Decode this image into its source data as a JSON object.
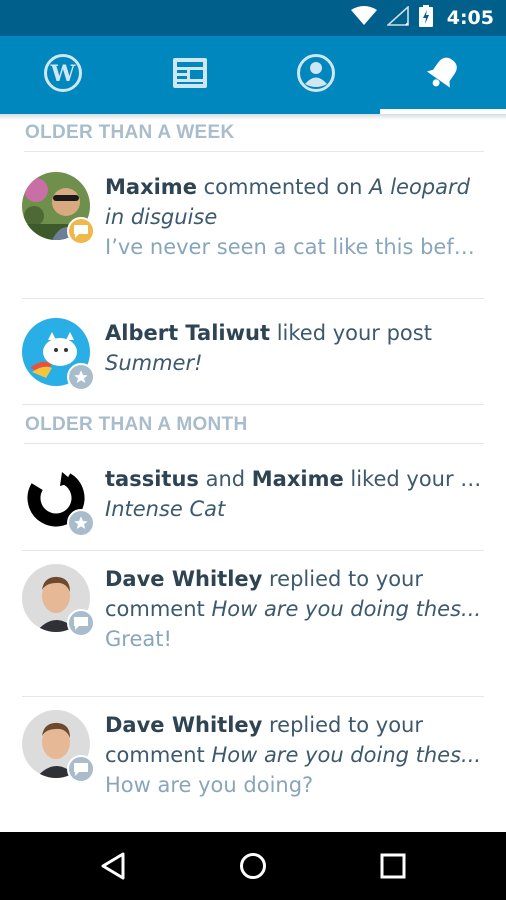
{
  "status_bar": {
    "time": "4:05"
  },
  "tabs": [
    {
      "icon": "wordpress-icon",
      "label": "My Sites",
      "active": false
    },
    {
      "icon": "reader-icon",
      "label": "Reader",
      "active": false
    },
    {
      "icon": "me-icon",
      "label": "Me",
      "active": false
    },
    {
      "icon": "notifications-bell-icon",
      "label": "Notifications",
      "active": true
    }
  ],
  "sections": [
    {
      "title": "OLDER THAN A WEEK"
    },
    {
      "title": "OLDER THAN A MONTH"
    }
  ],
  "notes": [
    {
      "actor": "Maxime",
      "action": " commented on ",
      "target": "A leopard in disguise",
      "snippet": "I’ve never seen a cat like this before!",
      "badge": "comment"
    },
    {
      "actor": "Albert Taliwut",
      "action": " liked your post",
      "target": "Summer!",
      "snippet": "",
      "badge": "star"
    },
    {
      "actor": "tassitus",
      "joiner": " and ",
      "actor2": "Maxime",
      "action": " liked your post",
      "target": "Intense Cat",
      "snippet": "",
      "badge": "star"
    },
    {
      "actor": "Dave Whitley",
      "action": " replied to your",
      "action2": "comment ",
      "target": "How are you doing thes...",
      "snippet": "Great!",
      "badge": "comment"
    },
    {
      "actor": "Dave Whitley",
      "action": " replied to your",
      "action2": "comment ",
      "target": "How are you doing thes...",
      "snippet": "How are you doing?",
      "badge": "comment"
    }
  ],
  "colors": {
    "status_bar": "#005f8b",
    "tab_bar": "#0087be",
    "badge_comment": "#f0b849",
    "badge_star": "#a8bccc",
    "section_header": "#a8bccc"
  }
}
